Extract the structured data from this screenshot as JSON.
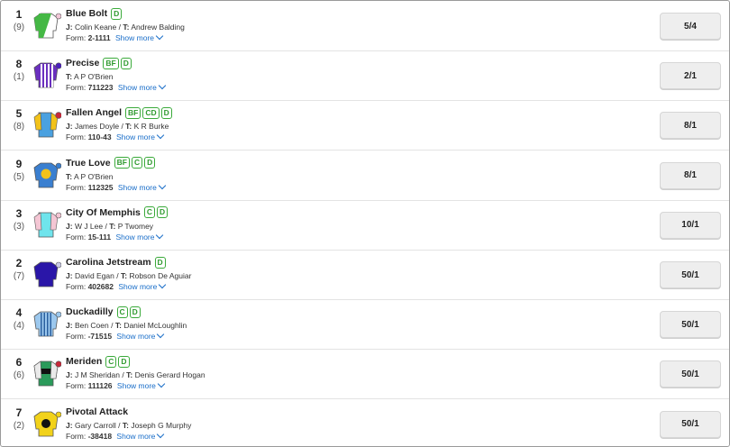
{
  "runners": [
    {
      "number": "1",
      "draw": "(9)",
      "name": "Blue Bolt",
      "badges": [
        "D"
      ],
      "jockey_label": "J:",
      "jockey": "Colin Keane",
      "trainer_label": "T:",
      "trainer": "Andrew Balding",
      "form_label": "Form:",
      "form": "2-1111",
      "show_more": "Show more",
      "odds": "5/4",
      "silk": "blue-bolt-silk"
    },
    {
      "number": "8",
      "draw": "(1)",
      "name": "Precise",
      "badges": [
        "BF",
        "D"
      ],
      "jockey_label": "",
      "jockey": "",
      "trainer_label": "T:",
      "trainer": "A P O'Brien",
      "form_label": "Form:",
      "form": "711223",
      "show_more": "Show more",
      "odds": "2/1",
      "silk": "precise-silk"
    },
    {
      "number": "5",
      "draw": "(8)",
      "name": "Fallen Angel",
      "badges": [
        "BF",
        "CD",
        "D"
      ],
      "jockey_label": "J:",
      "jockey": "James Doyle",
      "trainer_label": "T:",
      "trainer": "K R Burke",
      "form_label": "Form:",
      "form": "110-43",
      "show_more": "Show more",
      "odds": "8/1",
      "silk": "fallen-angel-silk"
    },
    {
      "number": "9",
      "draw": "(5)",
      "name": "True Love",
      "badges": [
        "BF",
        "C",
        "D"
      ],
      "jockey_label": "",
      "jockey": "",
      "trainer_label": "T:",
      "trainer": "A P O'Brien",
      "form_label": "Form:",
      "form": "112325",
      "show_more": "Show more",
      "odds": "8/1",
      "silk": "true-love-silk"
    },
    {
      "number": "3",
      "draw": "(3)",
      "name": "City Of Memphis",
      "badges": [
        "C",
        "D"
      ],
      "jockey_label": "J:",
      "jockey": "W J Lee",
      "trainer_label": "T:",
      "trainer": "P Twomey",
      "form_label": "Form:",
      "form": "15-111",
      "show_more": "Show more",
      "odds": "10/1",
      "silk": "city-of-memphis-silk"
    },
    {
      "number": "2",
      "draw": "(7)",
      "name": "Carolina Jetstream",
      "badges": [
        "D"
      ],
      "jockey_label": "J:",
      "jockey": "David Egan",
      "trainer_label": "T:",
      "trainer": "Robson De Aguiar",
      "form_label": "Form:",
      "form": "402682",
      "show_more": "Show more",
      "odds": "50/1",
      "silk": "carolina-jetstream-silk"
    },
    {
      "number": "4",
      "draw": "(4)",
      "name": "Duckadilly",
      "badges": [
        "C",
        "D"
      ],
      "jockey_label": "J:",
      "jockey": "Ben Coen",
      "trainer_label": "T:",
      "trainer": "Daniel McLoughlin",
      "form_label": "Form:",
      "form": "-71515",
      "show_more": "Show more",
      "odds": "50/1",
      "silk": "duckadilly-silk"
    },
    {
      "number": "6",
      "draw": "(6)",
      "name": "Meriden",
      "badges": [
        "C",
        "D"
      ],
      "jockey_label": "J:",
      "jockey": "J M Sheridan",
      "trainer_label": "T:",
      "trainer": "Denis Gerard Hogan",
      "form_label": "Form:",
      "form": "111126",
      "show_more": "Show more",
      "odds": "50/1",
      "silk": "meriden-silk"
    },
    {
      "number": "7",
      "draw": "(2)",
      "name": "Pivotal Attack",
      "badges": [],
      "jockey_label": "J:",
      "jockey": "Gary Carroll",
      "trainer_label": "T:",
      "trainer": "Joseph G Murphy",
      "form_label": "Form:",
      "form": "-38418",
      "show_more": "Show more",
      "odds": "50/1",
      "silk": "pivotal-attack-silk"
    }
  ],
  "colors": {
    "badge_green": "#3aaa3a",
    "link_blue": "#1a6ec9",
    "odds_bg": "#eeeeee"
  }
}
